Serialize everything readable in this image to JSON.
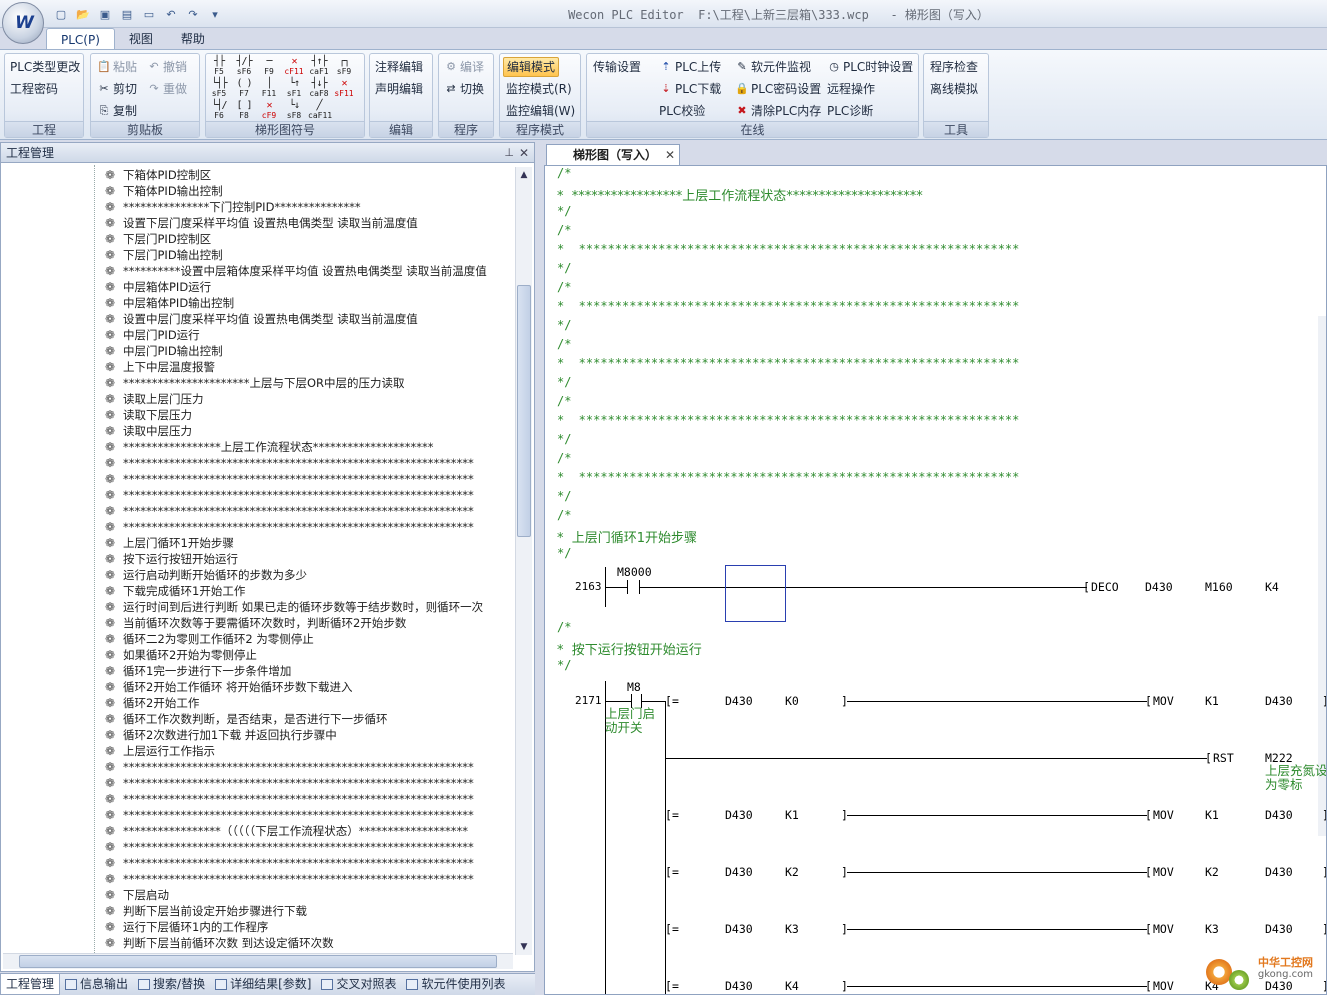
{
  "titlebar": {
    "title": "Wecon PLC Editor  F:\\工程\\上新三层箱\\333.wcp   - 梯形图（写入）",
    "logo_text": "W"
  },
  "quick_access": [
    "new-icon",
    "open-icon",
    "save-icon",
    "save-as-icon",
    "folder-icon",
    "undo-icon",
    "redo-icon",
    "customize-icon"
  ],
  "menu_tabs": [
    "PLC(P)",
    "视图",
    "帮助"
  ],
  "ribbon": {
    "groups": [
      {
        "label": "工程",
        "buttons": [
          "PLC类型更改",
          "工程密码"
        ]
      },
      {
        "label": "剪贴板",
        "buttons": [
          "粘贴",
          "撤销",
          "剪切",
          "重做",
          "复制"
        ]
      },
      {
        "label": "梯形图符号",
        "symbols": [
          "F5",
          "sF6",
          "F9",
          "cF11",
          "caF1",
          "sF9",
          "sF5",
          "F7",
          "F11",
          "sF1",
          "caF8",
          "sF11",
          "F6",
          "F8",
          "cF9",
          "sF8",
          "caF11"
        ]
      },
      {
        "label": "编辑",
        "buttons": [
          "注释编辑",
          "声明编辑"
        ]
      },
      {
        "label": "程序",
        "buttons": [
          "编译",
          "切换"
        ]
      },
      {
        "label": "程序模式",
        "buttons": [
          "编辑模式",
          "监控模式(R)",
          "监控编辑(W)"
        ]
      },
      {
        "label": "在线",
        "buttons": [
          "传输设置",
          "PLC上传",
          "PLC下载",
          "PLC校验",
          "软元件监视",
          "PLC密码设置",
          "清除PLC内存",
          "PLC时钟设置",
          "远程操作",
          "PLC诊断"
        ]
      },
      {
        "label": "工具",
        "buttons": [
          "程序检查",
          "离线模拟"
        ]
      }
    ]
  },
  "left_panel": {
    "title": "工程管理",
    "tree_items": [
      "下箱体PID控制区",
      "下箱体PID输出控制",
      "***************下门控制PID***************",
      "设置下层门度采样平均值 设置热电偶类型 读取当前温度值",
      "下层门PID控制区",
      "下层门PID输出控制",
      "**********设置中层箱体度采样平均值 设置热电偶类型 读取当前温度值",
      "中层箱体PID运行",
      "中层箱体PID输出控制",
      "设置中层门度采样平均值 设置热电偶类型 读取当前温度值",
      "中层门PID运行",
      "中层门PID输出控制",
      "上下中层温度报警",
      "**********************上层与下层OR中层的压力读取",
      "读取上层门压力",
      "读取下层压力",
      "读取中层压力",
      "*****************上层工作流程状态*********************",
      "*************************************************************",
      "*************************************************************",
      "*************************************************************",
      "*************************************************************",
      "*************************************************************",
      "上层门循环1开始步骤",
      "按下运行按钮开始运行",
      "运行启动判断开始循环的步数为多少",
      "下载完成循环1开始工作",
      "运行时间到后进行判断 如果已走的循环步数等于结步数时，则循环一次",
      "当前循环次数等于要需循环次数时，判断循环2开始步数",
      "循环二2为零则工作循环2 为零侧停止",
      "如果循环2开始为零侧停止",
      "循环1完一步进行下一步条件增加",
      "循环2开始工作循环 将开始循环步数下载进入",
      "循环2开始工作",
      "循环工作次数判断，是否结束，是否进行下一步循环",
      "循环2次数进行加1下载 并返回执行步骤中",
      "上层运行工作指示",
      "*************************************************************",
      "*************************************************************",
      "*************************************************************",
      "*************************************************************",
      "*****************（（（（（下层工作流程状态）*******************",
      "*************************************************************",
      "*************************************************************",
      "*************************************************************",
      "下层启动",
      "判断下层当前设定开始步骤进行下载",
      "运行下层循环1内的工作程序",
      "判断下层当前循环次数 到达设定循环次数"
    ]
  },
  "bottom_tabs": [
    "工程管理",
    "信息输出",
    "搜索/替换",
    "详细结果[参数]",
    "交叉对照表",
    "软元件使用列表"
  ],
  "document_tab": "梯形图（写入）",
  "ladder": {
    "comments": [
      {
        "text": "*  *****************上层工作流程状态*********************"
      },
      {
        "text": "*  *************************************************************"
      },
      {
        "text": "*  *************************************************************"
      },
      {
        "text": "*  *************************************************************"
      },
      {
        "text": "*  *************************************************************"
      },
      {
        "text": "*  *************************************************************"
      },
      {
        "text": "*  上层门循环1开始步骤"
      }
    ],
    "rung1": {
      "step": "2163",
      "contact": "M8000",
      "instr": "DECO",
      "ops": [
        "D430",
        "M160",
        "K4"
      ]
    },
    "comment2": "*  按下运行按钮开始运行",
    "rung2": {
      "step": "2171",
      "contact": "M8",
      "contact_note": "上层门启动开关",
      "rows": [
        {
          "cmp": "=",
          "a": "D430",
          "b": "K0",
          "instr": "MOV",
          "p1": "K1",
          "p2": "D430"
        },
        {
          "instr": "RST",
          "p1": "M222",
          "note": "上层充氮设为零标"
        },
        {
          "cmp": "=",
          "a": "D430",
          "b": "K1",
          "instr": "MOV",
          "p1": "K1",
          "p2": "D430"
        },
        {
          "cmp": "=",
          "a": "D430",
          "b": "K2",
          "instr": "MOV",
          "p1": "K2",
          "p2": "D430"
        },
        {
          "cmp": "=",
          "a": "D430",
          "b": "K3",
          "instr": "MOV",
          "p1": "K3",
          "p2": "D430"
        },
        {
          "cmp": "=",
          "a": "D430",
          "b": "K4",
          "instr": "MOV",
          "p1": "K4",
          "p2": "D430"
        }
      ]
    }
  },
  "watermark": {
    "line1": "中华工控网",
    "line2": "gkong.com"
  }
}
